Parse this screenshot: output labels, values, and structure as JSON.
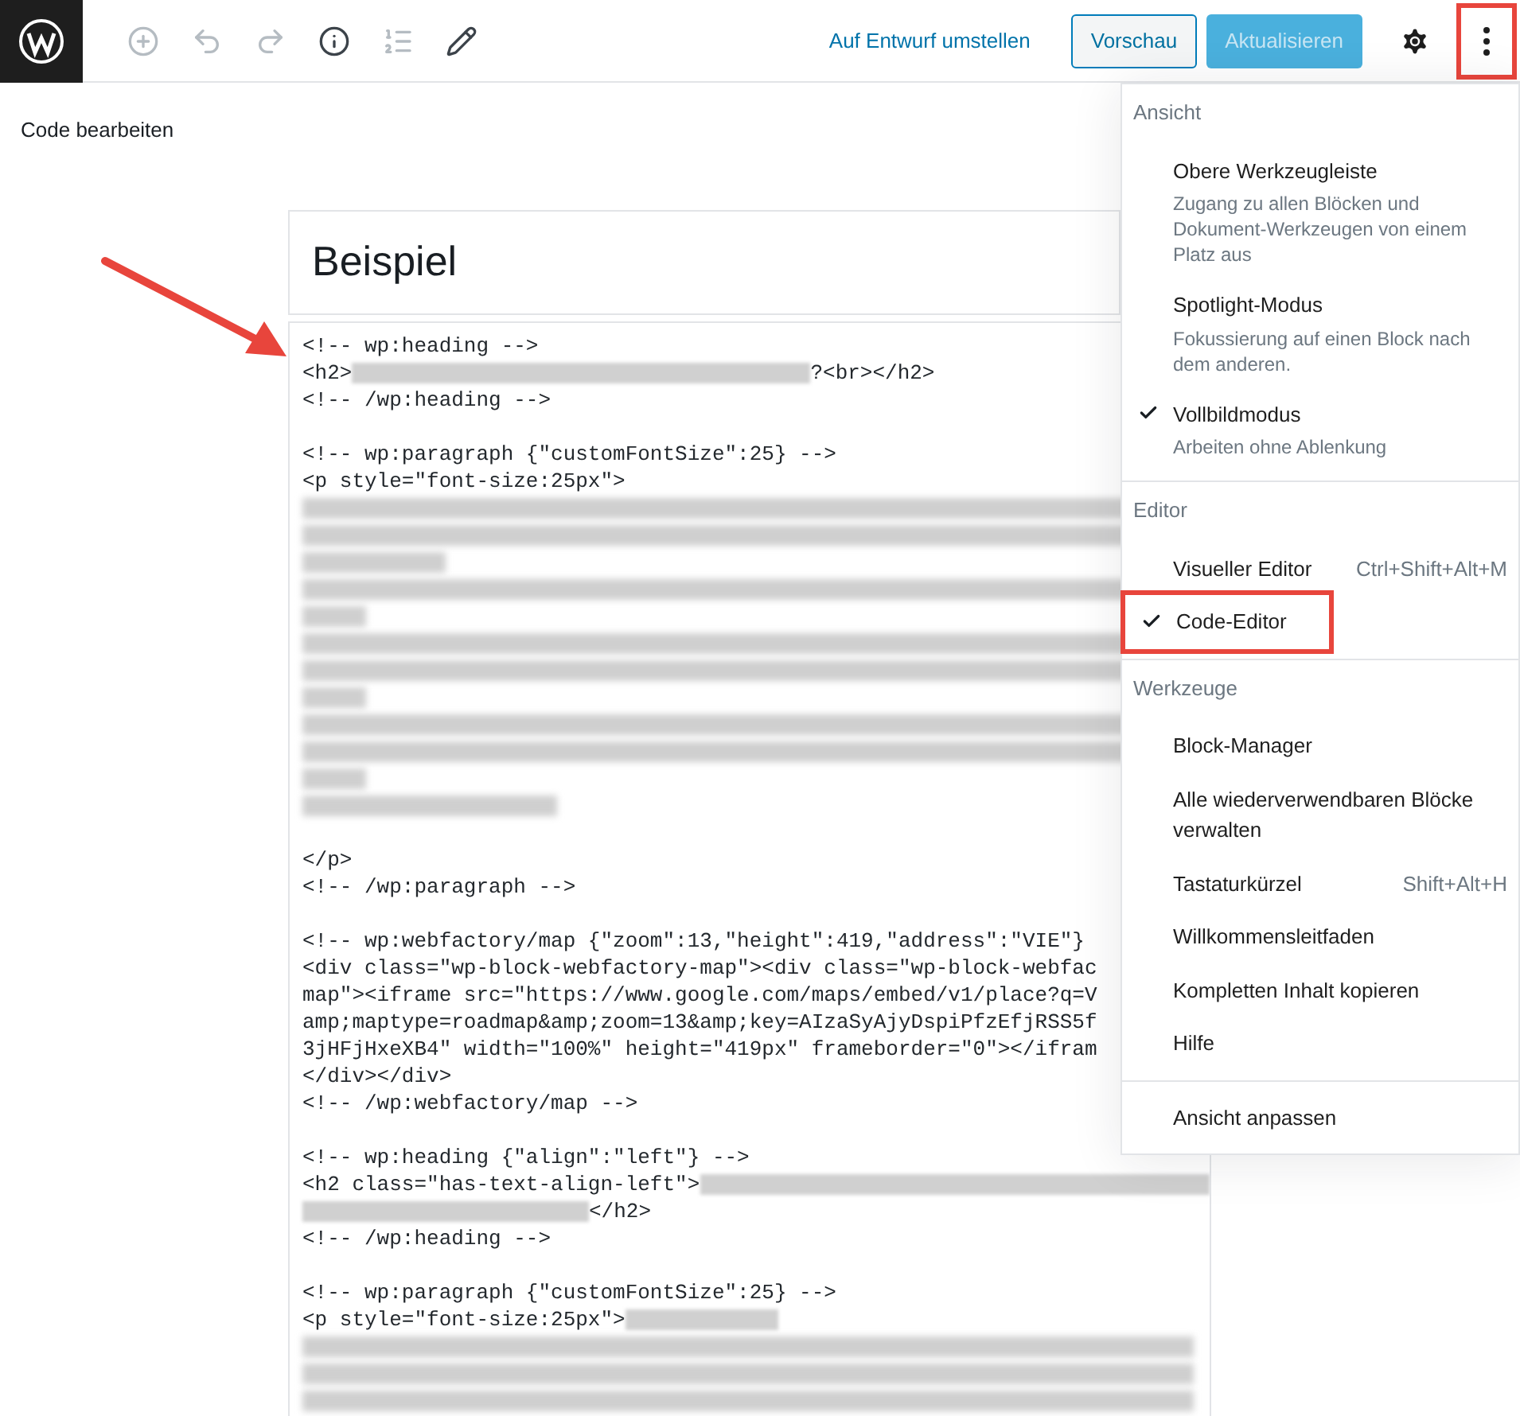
{
  "topbar": {
    "toolbar": [
      {
        "kind": "add",
        "disabled": true
      },
      {
        "kind": "undo",
        "disabled": true
      },
      {
        "kind": "redo",
        "disabled": true
      },
      {
        "kind": "info",
        "disabled": false
      },
      {
        "kind": "outline",
        "disabled": true
      },
      {
        "kind": "edit",
        "disabled": false
      }
    ],
    "draft_link": "Auf Entwurf umstellen",
    "preview_button": "Vorschau",
    "update_button": {
      "label": "Aktualisieren",
      "disabled": true
    },
    "menu_button": {
      "highlighted": true
    }
  },
  "editor": {
    "mode_label": "Code bearbeiten",
    "title": "Beispiel",
    "code_lines": [
      {
        "kind": "text",
        "parts": [
          {
            "kind": "code",
            "text": "<!-- wp:heading -->"
          }
        ]
      },
      {
        "kind": "text",
        "parts": [
          {
            "kind": "code",
            "text": "<h2>"
          },
          {
            "kind": "blurred"
          },
          {
            "kind": "code",
            "text": "?<br></h2>"
          }
        ]
      },
      {
        "kind": "text",
        "parts": [
          {
            "kind": "code",
            "text": "<!-- /wp:heading -->"
          }
        ]
      },
      {
        "kind": "blank"
      },
      {
        "kind": "text",
        "parts": [
          {
            "kind": "code",
            "text": "<!-- wp:paragraph {\"customFontSize\":25} -->"
          }
        ]
      },
      {
        "kind": "text",
        "parts": [
          {
            "kind": "code",
            "text": "<p style=\"font-size:25px\">"
          }
        ]
      },
      {
        "kind": "blurred"
      },
      {
        "kind": "blurred"
      },
      {
        "kind": "blurred"
      },
      {
        "kind": "blurred"
      },
      {
        "kind": "blurred"
      },
      {
        "kind": "blurred"
      },
      {
        "kind": "blurred"
      },
      {
        "kind": "blurred"
      },
      {
        "kind": "blurred"
      },
      {
        "kind": "blurred"
      },
      {
        "kind": "blurred"
      },
      {
        "kind": "blurred"
      },
      {
        "kind": "blank"
      },
      {
        "kind": "text",
        "parts": [
          {
            "kind": "code",
            "text": "</p>"
          }
        ]
      },
      {
        "kind": "text",
        "parts": [
          {
            "kind": "code",
            "text": "<!-- /wp:paragraph -->"
          }
        ]
      },
      {
        "kind": "blank"
      },
      {
        "kind": "text",
        "parts": [
          {
            "kind": "code",
            "text": "<!-- wp:webfactory/map {\"zoom\":13,\"height\":419,\"address\":\"VIE\"}"
          }
        ]
      },
      {
        "kind": "text",
        "parts": [
          {
            "kind": "code",
            "text": "<div class=\"wp-block-webfactory-map\"><div class=\"wp-block-webfac"
          }
        ]
      },
      {
        "kind": "text",
        "parts": [
          {
            "kind": "code",
            "text": "map\"><iframe src=\"https://www.google.com/maps/embed/v1/place?q=V"
          }
        ]
      },
      {
        "kind": "text",
        "parts": [
          {
            "kind": "code",
            "text": "amp;maptype=roadmap&amp;zoom=13&amp;key=AIzaSyAjyDspiPfzEfjRSS5f"
          }
        ]
      },
      {
        "kind": "text",
        "parts": [
          {
            "kind": "code",
            "text": "3jHFjHxeXB4\" width=\"100%\" height=\"419px\" frameborder=\"0\"></ifram"
          }
        ]
      },
      {
        "kind": "text",
        "parts": [
          {
            "kind": "code",
            "text": "</div></div>"
          }
        ]
      },
      {
        "kind": "text",
        "parts": [
          {
            "kind": "code",
            "text": "<!-- /wp:webfactory/map -->"
          }
        ]
      },
      {
        "kind": "blank"
      },
      {
        "kind": "text",
        "parts": [
          {
            "kind": "code",
            "text": "<!-- wp:heading {\"align\":\"left\"} -->"
          }
        ]
      },
      {
        "kind": "text",
        "parts": [
          {
            "kind": "code",
            "text": "<h2 class=\"has-text-align-left\">"
          },
          {
            "kind": "blurred"
          }
        ]
      },
      {
        "kind": "text",
        "parts": [
          {
            "kind": "blurred"
          },
          {
            "kind": "code",
            "text": "</h2>"
          }
        ]
      },
      {
        "kind": "text",
        "parts": [
          {
            "kind": "code",
            "text": "<!-- /wp:heading -->"
          }
        ]
      },
      {
        "kind": "blank"
      },
      {
        "kind": "text",
        "parts": [
          {
            "kind": "code",
            "text": "<!-- wp:paragraph {\"customFontSize\":25} -->"
          }
        ]
      },
      {
        "kind": "text",
        "parts": [
          {
            "kind": "code",
            "text": "<p style=\"font-size:25px\">"
          },
          {
            "kind": "blurred"
          }
        ]
      },
      {
        "kind": "blurred"
      },
      {
        "kind": "blurred"
      },
      {
        "kind": "blurred"
      }
    ]
  },
  "menu": {
    "sections": [
      {
        "heading": "Ansicht",
        "items": [
          {
            "label": "Obere Werkzeugleiste",
            "description": "Zugang zu allen Blöcken und Dokument-Werkzeugen von einem Platz aus",
            "checked": false,
            "highlighted": false
          },
          {
            "label": "Spotlight-Modus",
            "description": "Fokussierung auf einen Block nach dem anderen.",
            "checked": false,
            "highlighted": false
          },
          {
            "label": "Vollbildmodus",
            "description": "Arbeiten ohne Ablenkung",
            "checked": true,
            "highlighted": false
          }
        ]
      },
      {
        "heading": "Editor",
        "items": [
          {
            "label": "Visueller Editor",
            "shortcut": "Ctrl+Shift+Alt+M",
            "checked": false,
            "highlighted": false
          },
          {
            "label": "Code-Editor",
            "checked": true,
            "highlighted": true
          }
        ]
      },
      {
        "heading": "Werkzeuge",
        "items": [
          {
            "label": "Block-Manager",
            "checked": false,
            "highlighted": false
          },
          {
            "label": "Alle wiederverwendbaren Blöcke verwalten",
            "checked": false,
            "highlighted": false
          },
          {
            "label": "Tastaturkürzel",
            "shortcut": "Shift+Alt+H",
            "checked": false,
            "highlighted": false
          },
          {
            "label": "Willkommensleitfaden",
            "checked": false,
            "highlighted": false
          },
          {
            "label": "Kompletten Inhalt kopieren",
            "checked": false,
            "highlighted": false
          },
          {
            "label": "Hilfe",
            "checked": false,
            "highlighted": false
          }
        ]
      },
      {
        "items": [
          {
            "label": "Ansicht anpassen",
            "checked": false,
            "highlighted": false
          }
        ]
      }
    ]
  }
}
